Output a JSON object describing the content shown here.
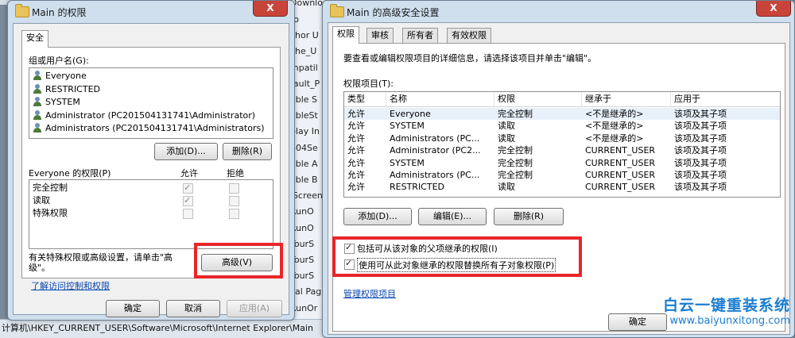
{
  "background": {
    "top_label": "Download",
    "explorer_fragments": [
      "ro",
      "chor U",
      "che_U",
      "mpatil",
      "fault_P",
      "able S",
      "ableSt",
      "play In",
      "404Se",
      "able A",
      "able B",
      "lScreen",
      "RunO",
      "RunO",
      "TourS",
      "TourS",
      "TourS",
      "cal Pag",
      "RunOr"
    ],
    "status_path": "计算机\\HKEY_CURRENT_USER\\Software\\Microsoft\\Internet Explorer\\Main"
  },
  "perm_dialog": {
    "title": "Main 的权限",
    "close_label": "X",
    "tab_security": "安全",
    "group_label": "组或用户名(G):",
    "users": [
      "Everyone",
      "RESTRICTED",
      "SYSTEM",
      "Administrator (PC201504131741\\Administrator)",
      "Administrators (PC201504131741\\Administrators)"
    ],
    "add_label": "添加(D)...",
    "remove_label": "删除(R)",
    "perm_for_label": "Everyone 的权限(P)",
    "allow_label": "允许",
    "deny_label": "拒绝",
    "perms": [
      {
        "name": "完全控制",
        "allow": true,
        "deny": false
      },
      {
        "name": "读取",
        "allow": true,
        "deny": false
      },
      {
        "name": "特殊权限",
        "allow": false,
        "deny": false
      }
    ],
    "special_note": "有关特殊权限或高级设置，请单击\"高级\"。",
    "advanced_label": "高级(V)",
    "learn_link": "了解访问控制和权限",
    "ok_label": "确定",
    "cancel_label": "取消",
    "apply_label": "应用(A)"
  },
  "adv_dialog": {
    "title": "Main 的高级安全设置",
    "tabs": [
      "权限",
      "审核",
      "所有者",
      "有效权限"
    ],
    "info_text": "要查看或编辑权限项目的详细信息，请选择该项目并单击\"编辑\"。",
    "entries_label": "权限项目(T):",
    "columns": [
      "类型",
      "名称",
      "权限",
      "继承于",
      "应用于"
    ],
    "rows": [
      [
        "允许",
        "Everyone",
        "完全控制",
        "<不是继承的>",
        "该项及其子项"
      ],
      [
        "允许",
        "SYSTEM",
        "读取",
        "<不是继承的>",
        "该项及其子项"
      ],
      [
        "允许",
        "Administrators (PC...",
        "读取",
        "<不是继承的>",
        "该项及其子项"
      ],
      [
        "允许",
        "Administrator (PC2...",
        "完全控制",
        "CURRENT_USER",
        "该项及其子项"
      ],
      [
        "允许",
        "SYSTEM",
        "完全控制",
        "CURRENT_USER",
        "该项及其子项"
      ],
      [
        "允许",
        "Administrators (PC...",
        "完全控制",
        "CURRENT_USER",
        "该项及其子项"
      ],
      [
        "允许",
        "RESTRICTED",
        "读取",
        "CURRENT_USER",
        "该项及其子项"
      ]
    ],
    "add_label": "添加(D)...",
    "edit_label": "编辑(E)...",
    "remove_label": "删除(R)",
    "inherit_checkbox": "包括可从该对象的父项继承的权限(I)",
    "inherit_checked": true,
    "replace_checkbox": "使用可从此对象继承的权限替换所有子对象权限(P)",
    "replace_checked": true,
    "manage_link": "管理权限项目",
    "ok_label": "确定"
  },
  "watermark": {
    "line1": "白云一键重装系统",
    "line2": "www.baiyunxitong.com"
  },
  "colors": {
    "highlight": "#e8262a",
    "link": "#0645ad",
    "watermark": "#1a7ed0"
  }
}
